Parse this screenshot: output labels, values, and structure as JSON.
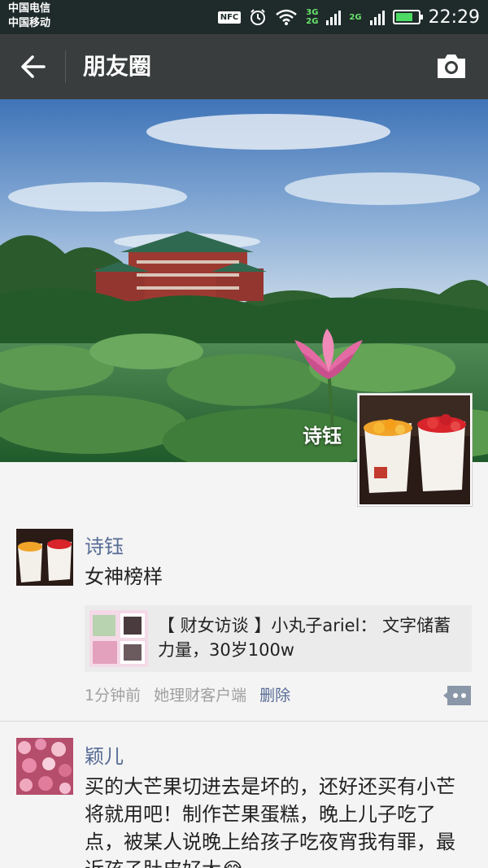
{
  "status_bar": {
    "carrier_1": "中国电信",
    "carrier_2": "中国移动",
    "nfc": "NFC",
    "net_3g": "3G",
    "net_2g_a": "2G",
    "net_2g_b": "2G",
    "battery_level": 0.8,
    "time": "22:29"
  },
  "header": {
    "title": "朋友圈"
  },
  "cover": {
    "name": "诗钰"
  },
  "posts": [
    {
      "username": "诗钰",
      "text": "女神榜样",
      "share": {
        "title": "【 财女访谈 】小丸子ariel： 文字储蓄力量，30岁100w"
      },
      "time": "1分钟前",
      "source": "她理财客户端",
      "delete": "删除"
    },
    {
      "username": "颖儿",
      "text": "买的大芒果切进去是坏的，还好还买有小芒将就用吧！制作芒果蛋糕，晚上儿子吃了点，被某人说晚上给孩子吃夜宵我有罪，最近孩子肚皮好大😂"
    }
  ],
  "icons": {
    "back": "arrow-left-icon",
    "camera": "camera-icon",
    "comment": "comment-dots-icon"
  },
  "colors": {
    "title_bar": "#3a3d3e",
    "username": "#576b95",
    "status_bar": "#1e2b2a"
  }
}
